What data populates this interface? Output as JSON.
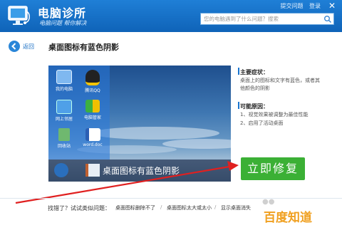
{
  "app": {
    "name": "电脑诊所",
    "slogan": "电脑问题  帮你解决",
    "links": [
      "提交问题",
      "登录"
    ]
  },
  "search": {
    "placeholder": "您的电脑遇到了什么问题？搜索"
  },
  "nav": {
    "back_label": "返回",
    "title": "桌面图标有蓝色阴影"
  },
  "preview": {
    "icons": [
      "我的电脑",
      "腾讯QQ",
      "网上邻居",
      "电脑管家",
      "回收站",
      "word.doc"
    ],
    "caption": "桌面图标有蓝色阴影"
  },
  "symptoms": {
    "title": "主要症状：",
    "text": [
      "桌面上的图标和文字有蓝色，或者其",
      "他颜色的阴影"
    ]
  },
  "causes": {
    "title": "可能原因：",
    "items": [
      "1、视觉效果被调整为最佳性能",
      "2、启用了活动桌面"
    ]
  },
  "fix_button": "立即修复",
  "related": {
    "label": "找错了？试试类似问题：",
    "links": [
      "桌面图标删除不了",
      "桌面图标太大或太小",
      "显示桌面消失"
    ]
  },
  "watermark": "百度知道",
  "colors": {
    "title_bar": "#1a73cc",
    "fix_button": "#3bb035",
    "accent": "#1a75cf",
    "arrow": "#e02020"
  }
}
